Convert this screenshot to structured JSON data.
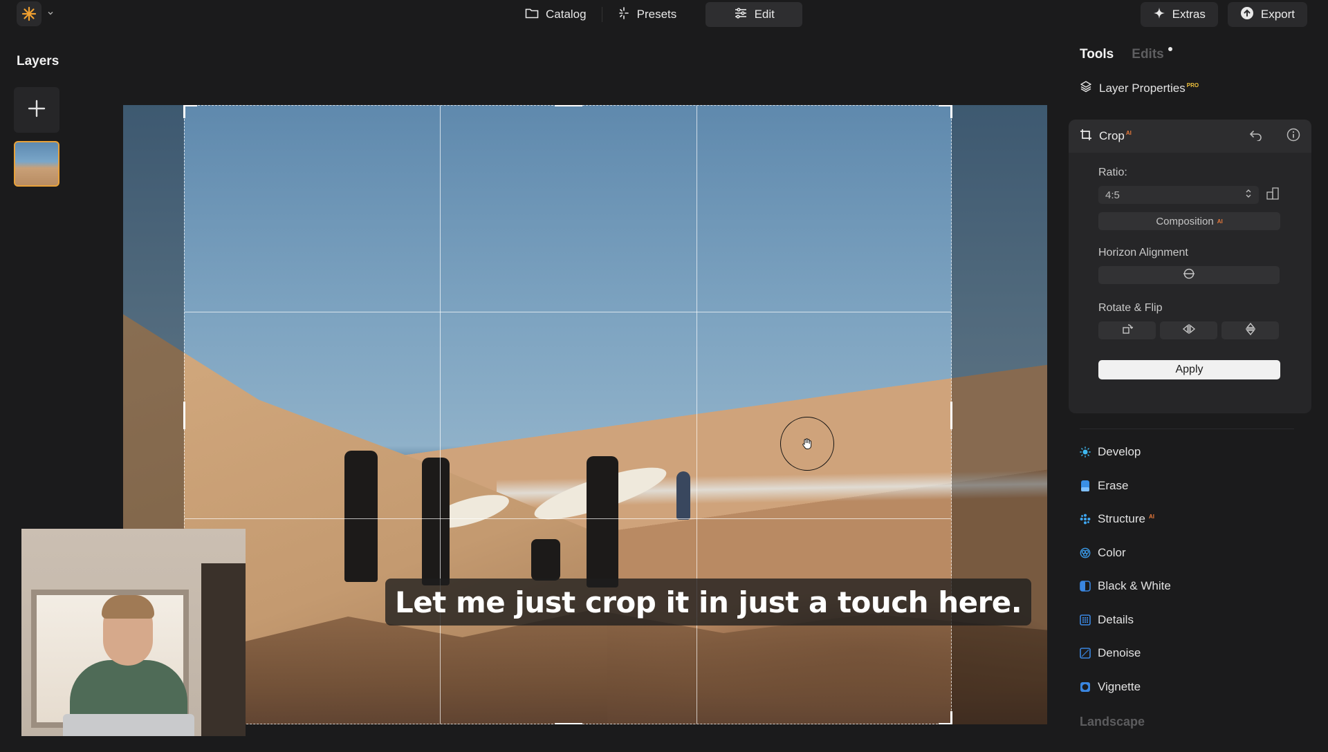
{
  "topbar": {
    "tabs": [
      {
        "label": "Catalog",
        "icon": "folder-icon"
      },
      {
        "label": "Presets",
        "icon": "sparkle-icon"
      },
      {
        "label": "Edit",
        "icon": "sliders-icon",
        "active": true
      }
    ],
    "extras_label": "Extras",
    "export_label": "Export"
  },
  "layers": {
    "title": "Layers"
  },
  "canvas": {
    "caption": "Let me just crop it in just a touch here."
  },
  "right_panel": {
    "tabs": {
      "tools": "Tools",
      "edits": "Edits"
    },
    "layer_properties": {
      "label": "Layer Properties",
      "badge": "PRO"
    },
    "crop": {
      "title": "Crop",
      "badge": "AI",
      "ratio_label": "Ratio:",
      "ratio_value": "4:5",
      "composition_label": "Composition",
      "composition_badge": "AI",
      "horizon_label": "Horizon Alignment",
      "rotate_label": "Rotate & Flip",
      "apply_label": "Apply"
    },
    "tools": [
      {
        "label": "Develop",
        "icon": "develop-icon",
        "color": "#3fb8f0"
      },
      {
        "label": "Erase",
        "icon": "erase-icon",
        "color": "#3a8fe6"
      },
      {
        "label": "Structure",
        "icon": "structure-icon",
        "color": "#3fa6f0",
        "badge": "AI"
      },
      {
        "label": "Color",
        "icon": "color-icon",
        "color": "#3a9ae8"
      },
      {
        "label": "Black & White",
        "icon": "black-white-icon",
        "color": "#3a86e0"
      },
      {
        "label": "Details",
        "icon": "details-icon",
        "color": "#3a86e0"
      },
      {
        "label": "Denoise",
        "icon": "denoise-icon",
        "color": "#3a86e0"
      },
      {
        "label": "Vignette",
        "icon": "vignette-icon",
        "color": "#3a86e0"
      }
    ],
    "section_label": "Landscape"
  },
  "colors": {
    "background": "#1b1b1c",
    "accent_orange": "#e8a23a",
    "pro_badge": "#f0c23c",
    "ai_badge": "#e8793a"
  }
}
